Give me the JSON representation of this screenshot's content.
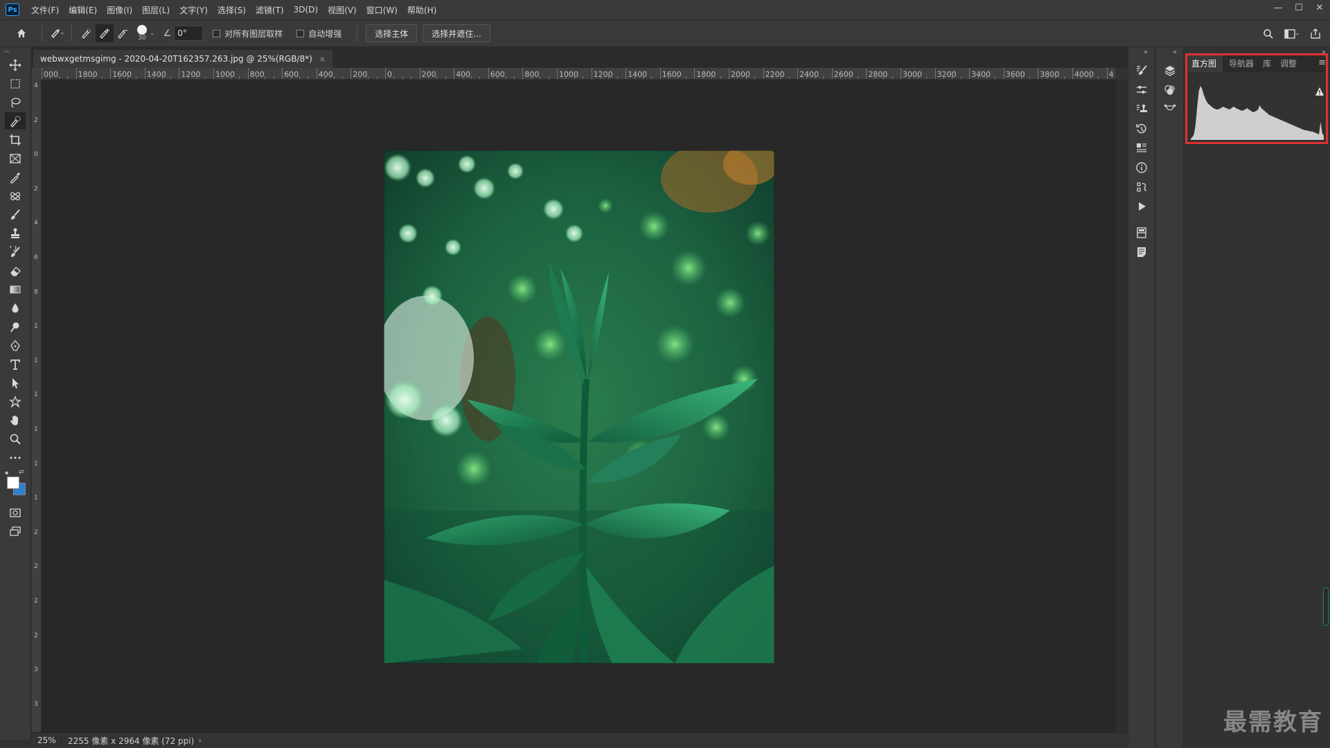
{
  "app": {
    "logo_text": "Ps",
    "menu": [
      "文件(F)",
      "编辑(E)",
      "图像(I)",
      "图层(L)",
      "文字(Y)",
      "选择(S)",
      "滤镜(T)",
      "3D(D)",
      "视图(V)",
      "窗口(W)",
      "帮助(H)"
    ],
    "window_controls": [
      "—",
      "☐",
      "✕"
    ]
  },
  "options": {
    "brush_size": "30",
    "angle_value": "0°",
    "sample_all_layers_label": "对所有图层取样",
    "auto_enhance_label": "自动增强",
    "select_subject_label": "选择主体",
    "select_and_mask_label": "选择并遮住..."
  },
  "document": {
    "tab_title": "webwxgetmsgimg - 2020-04-20T162357.263.jpg @ 25%(RGB/8*)",
    "tab_close": "×"
  },
  "ruler": {
    "top_ticks": [
      "000",
      "1800",
      "1600",
      "1400",
      "1200",
      "1000",
      "800",
      "600",
      "400",
      "200",
      "0",
      "200",
      "400",
      "600",
      "800",
      "1000",
      "1200",
      "1400",
      "1600",
      "1800",
      "2000",
      "2200",
      "2400",
      "2600",
      "2800",
      "3000",
      "3200",
      "3400",
      "3600",
      "3800",
      "4000",
      "4"
    ],
    "left_ticks": [
      "4",
      "2",
      "0",
      "2",
      "4",
      "6",
      "8",
      "1",
      "1",
      "1",
      "1",
      "1",
      "1",
      "2",
      "2",
      "2",
      "2",
      "3",
      "3"
    ]
  },
  "status": {
    "zoom": "25%",
    "info": "2255 像素 x 2964 像素 (72 ppi)",
    "arrow": "›"
  },
  "panel": {
    "tabs": [
      "直方图",
      "导航器",
      "库",
      "调整"
    ],
    "active_tab": "直方图",
    "menu_icon": "≡",
    "warning_icon": "!"
  },
  "histogram": {
    "color": "#cfcfcf",
    "levels": [
      2,
      4,
      8,
      22,
      48,
      70,
      78,
      74,
      66,
      60,
      55,
      52,
      50,
      48,
      46,
      45,
      44,
      44,
      45,
      46,
      48,
      47,
      46,
      45,
      44,
      45,
      47,
      48,
      46,
      45,
      44,
      43,
      42,
      43,
      44,
      46,
      44,
      43,
      41,
      40,
      41,
      42,
      44,
      50,
      46,
      44,
      42,
      40,
      38,
      36,
      35,
      34,
      33,
      32,
      31,
      30,
      29,
      28,
      27,
      26,
      25,
      24,
      23,
      22,
      21,
      20,
      19,
      18,
      17,
      16,
      15,
      14,
      14,
      13,
      13,
      12,
      12,
      11,
      10,
      9,
      8,
      26,
      10,
      6
    ]
  },
  "watermark": "最需教育",
  "colors": {
    "foreground": "#ffffff",
    "background": "#2e7fd0",
    "highlight": "#e03131"
  }
}
